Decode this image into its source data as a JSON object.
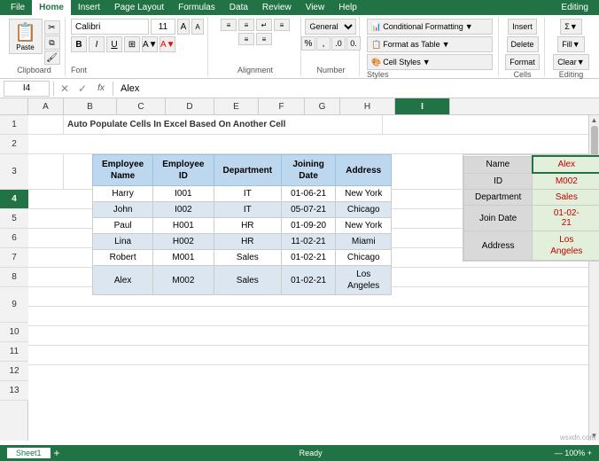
{
  "ribbon": {
    "tabs": [
      "File",
      "Home",
      "Insert",
      "Page Layout",
      "Formulas",
      "Data",
      "Review",
      "View",
      "Help"
    ],
    "active_tab": "Home",
    "accent_color": "#217346"
  },
  "toolbar": {
    "paste_label": "Paste",
    "clipboard_label": "Clipboard",
    "font_name": "Calibri",
    "font_size": "11",
    "alignment_label": "Alignment",
    "number_label": "Number",
    "conditional_format": "Conditional Formatting",
    "format_as_table": "Format as Table",
    "cell_styles": "Cell Styles",
    "styles_label": "Styles",
    "cells_label": "Cells",
    "editing_label": "Editing"
  },
  "formula_bar": {
    "cell_ref": "I4",
    "formula_value": "Alex"
  },
  "spreadsheet": {
    "title": "Auto Populate Cells In Excel Based On Another Cell",
    "col_headers": [
      "A",
      "B",
      "C",
      "D",
      "E",
      "F",
      "G",
      "H",
      "I"
    ],
    "active_col": "I",
    "active_row": 4
  },
  "employee_table": {
    "headers": [
      "Employee\nName",
      "Employee\nID",
      "Department",
      "Joining\nDate",
      "Address"
    ],
    "rows": [
      {
        "name": "Harry",
        "id": "I001",
        "dept": "IT",
        "date": "01-06-21",
        "address": "New York"
      },
      {
        "name": "John",
        "id": "I002",
        "dept": "IT",
        "date": "05-07-21",
        "address": "Chicago"
      },
      {
        "name": "Paul",
        "id": "H001",
        "dept": "HR",
        "date": "01-09-20",
        "address": "New York"
      },
      {
        "name": "Lina",
        "id": "H002",
        "dept": "HR",
        "date": "11-02-21",
        "address": "Miami"
      },
      {
        "name": "Robert",
        "id": "M001",
        "dept": "Sales",
        "date": "01-02-21",
        "address": "Chicago"
      },
      {
        "name": "Alex",
        "id": "M002",
        "dept": "Sales",
        "date": "01-02-21",
        "address": "Los\nAngeles"
      }
    ]
  },
  "info_panel": {
    "rows": [
      {
        "label": "Name",
        "value": "Alex"
      },
      {
        "label": "ID",
        "value": "M002"
      },
      {
        "label": "Department",
        "value": "Sales"
      },
      {
        "label": "Join Date",
        "value": "01-02-21"
      },
      {
        "label": "Address",
        "value": "Los\nAngeles"
      }
    ]
  },
  "bottom": {
    "sheet_name": "Sheet1",
    "status": "Ready"
  },
  "watermark": "wsxdn.com"
}
